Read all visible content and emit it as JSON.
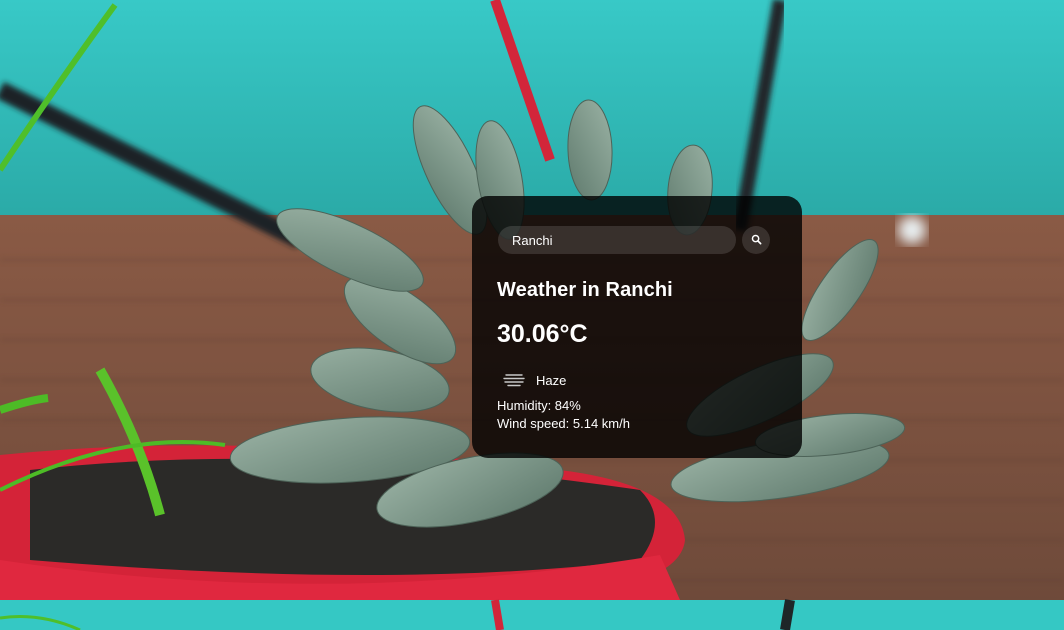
{
  "search": {
    "value": "Ranchi",
    "placeholder": "Search",
    "icon": "search-icon"
  },
  "weather": {
    "title": "Weather in Ranchi",
    "temperature": "30.06°C",
    "description": "Haze",
    "condition_icon": "haze-icon",
    "humidity": "Humidity: 84%",
    "wind": "Wind speed: 5.14 km/h"
  },
  "colors": {
    "card_background": "#000000cc",
    "text": "#ffffff"
  }
}
